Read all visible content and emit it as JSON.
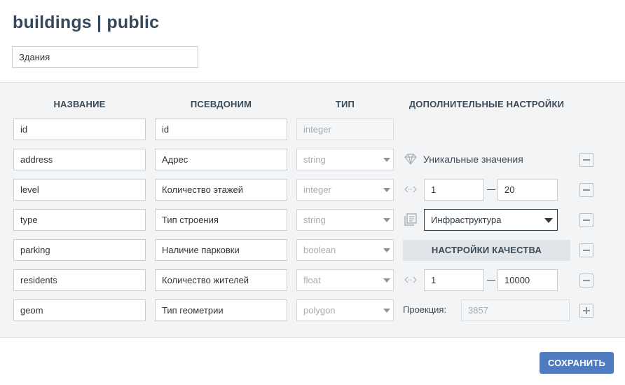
{
  "title": "buildings | public",
  "name_input": {
    "value": "Здания"
  },
  "columns": {
    "name": "НАЗВАНИЕ",
    "alias": "ПСЕВДОНИМ",
    "type": "ТИП",
    "extra": "ДОПОЛНИТЕЛЬНЫЕ НАСТРОЙКИ"
  },
  "rows": [
    {
      "name": "id",
      "alias": "id",
      "type": "integer",
      "type_editable": false
    },
    {
      "name": "address",
      "alias": "Адрес",
      "type": "string",
      "type_editable": true
    },
    {
      "name": "level",
      "alias": "Количество этажей",
      "type": "integer",
      "type_editable": true
    },
    {
      "name": "type",
      "alias": "Тип строения",
      "type": "string",
      "type_editable": true
    },
    {
      "name": "parking",
      "alias": "Наличие парковки",
      "type": "boolean",
      "type_editable": true
    },
    {
      "name": "residents",
      "alias": "Количество жителей",
      "type": "float",
      "type_editable": true
    },
    {
      "name": "geom",
      "alias": "Тип геометрии",
      "type": "polygon",
      "type_editable": true
    }
  ],
  "extras": {
    "address": {
      "icon": "diamond-icon",
      "label": "Уникальные значения"
    },
    "level": {
      "icon": "range-icon",
      "min": "1",
      "max": "20"
    },
    "type": {
      "icon": "catalog-icon",
      "selected": "Инфраструктура"
    },
    "parking": {
      "button_label": "НАСТРОЙКИ КАЧЕСТВА"
    },
    "residents": {
      "icon": "range-icon",
      "min": "1",
      "max": "10000"
    },
    "geom": {
      "label": "Проекция:",
      "value": "3857"
    }
  },
  "save_label": "СОХРАНИТЬ",
  "colors": {
    "accent": "#4f7cc1",
    "panel_bg": "#f3f4f6",
    "title": "#34495e"
  }
}
